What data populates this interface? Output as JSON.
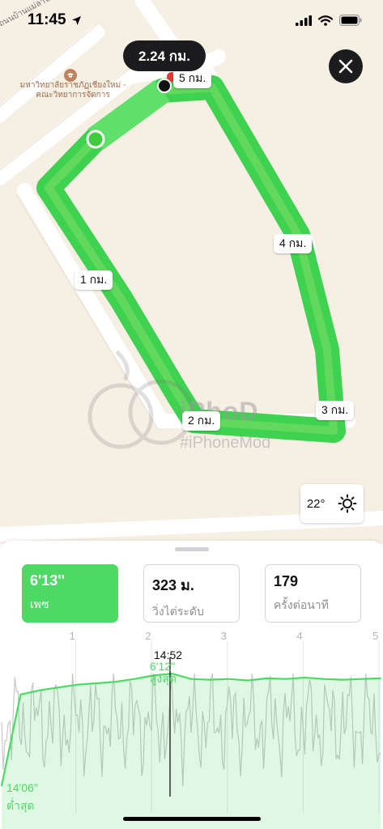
{
  "status_bar": {
    "time": "11:45"
  },
  "map": {
    "distance_bubble": "2.24 กม.",
    "km_markers": [
      "1 กม.",
      "2 กม.",
      "3 กม.",
      "4 กม.",
      "5 กม."
    ],
    "place_label": "มหาวิทยาลัยราชภัฏเชียงใหม่ - คณะวิทยาการจัดการ",
    "street_label": "ถนนบ้านแม่ลานไน",
    "weather": {
      "temperature": "22°",
      "icon": "sun-icon"
    },
    "watermark": {
      "text": "iPhoD",
      "hashtag": "#iPhoneMod"
    },
    "route_color": "#52d84a"
  },
  "metrics": {
    "pace": {
      "value": "6'13''",
      "label": "เพซ"
    },
    "elevation": {
      "value": "323 ม.",
      "label": "วิ่งไต่ระดับ"
    },
    "cadence": {
      "value": "179",
      "label": "ครั้งต่อนาที"
    }
  },
  "chart": {
    "x_ticks": [
      "1",
      "2",
      "3",
      "4",
      "5"
    ],
    "scrub_time": "14:52",
    "best_pace": {
      "value": "6'12''",
      "label": "สูงสุด"
    },
    "worst_pace": {
      "value": "14'06''",
      "label": "ต่ำสุด"
    }
  },
  "chart_data": {
    "type": "line",
    "x": [
      0,
      0.25,
      0.5,
      0.75,
      1,
      1.25,
      1.5,
      1.75,
      2,
      2.25,
      2.5,
      2.75,
      3,
      3.25,
      3.5,
      3.75,
      4,
      4.25,
      4.5,
      4.75,
      5
    ],
    "series": [
      {
        "values": [
          14.06,
          7.6,
          7.3,
          7.1,
          6.9,
          6.8,
          6.7,
          6.5,
          6.25,
          6.12,
          6.5,
          6.55,
          6.5,
          6.6,
          6.45,
          6.5,
          6.4,
          6.5,
          6.55,
          6.5,
          6.45
        ]
      }
    ],
    "xlim": [
      0,
      5
    ],
    "x_ticks": [
      1,
      2,
      3,
      4,
      5
    ],
    "grid": true
  }
}
